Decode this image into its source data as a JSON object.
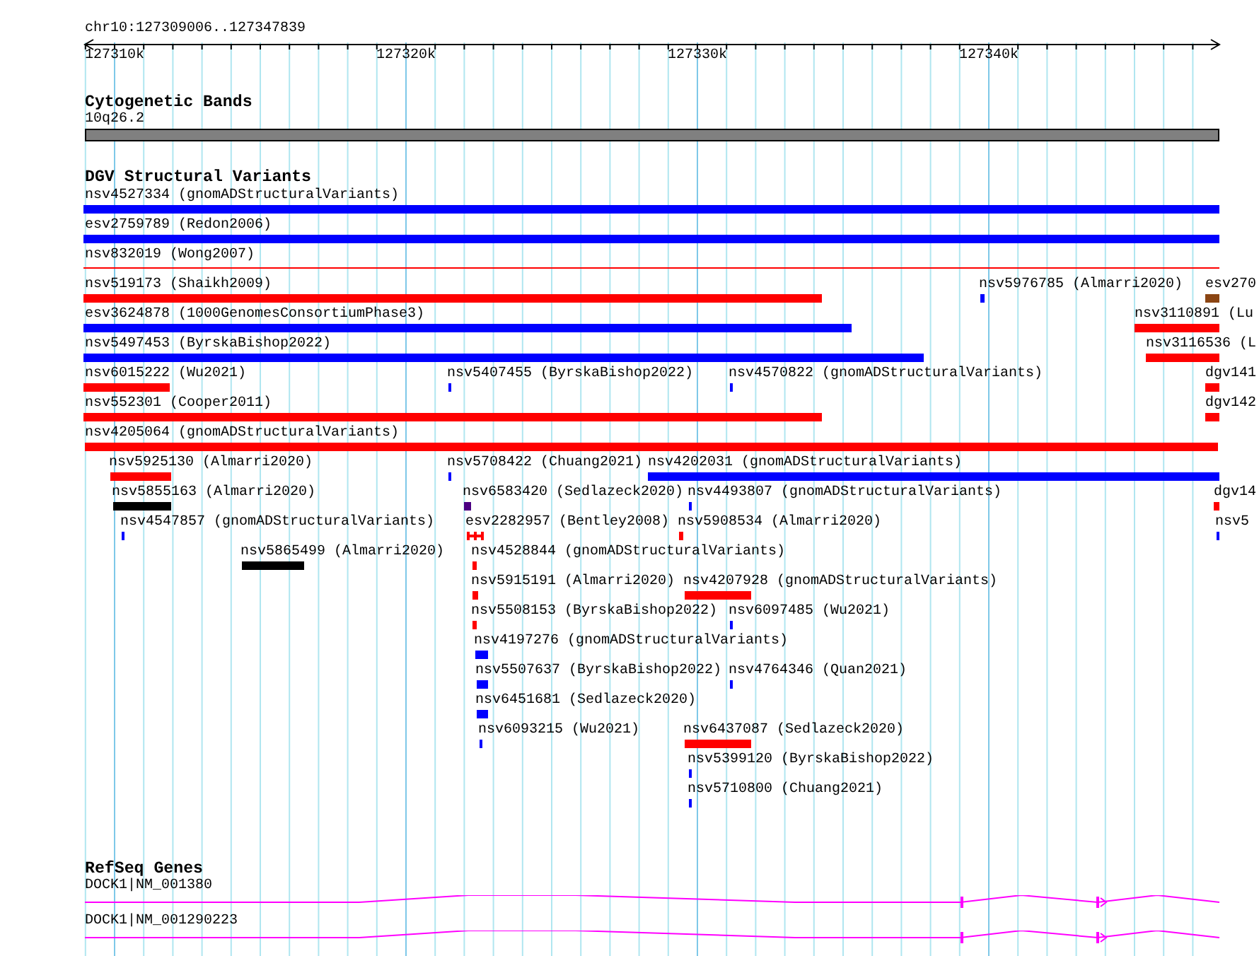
{
  "location": "chr10:127309006..127347839",
  "ruler": {
    "ticks": [
      "127310k",
      "127320k",
      "127330k",
      "127340k"
    ]
  },
  "tracks": [
    {
      "title": "Cytogenetic Bands",
      "kind": "bands",
      "features": [
        {
          "label": "10q26.2",
          "color": "#808080"
        }
      ]
    },
    {
      "title": "DGV Structural Variants",
      "kind": "variants",
      "rows": [
        {
          "features": [
            {
              "label": "nsv4527334 (gnomADStructuralVariants)",
              "kind": "bar",
              "color": "#0000ff"
            }
          ]
        },
        {
          "features": [
            {
              "label": "esv2759789 (Redon2006)",
              "kind": "bar",
              "color": "#0000ff"
            }
          ]
        },
        {
          "features": [
            {
              "label": "nsv832019 (Wong2007)",
              "kind": "line",
              "color": "#ff0000"
            }
          ]
        },
        {
          "features": [
            {
              "label": "nsv519173 (Shaikh2009)",
              "kind": "bar",
              "color": "#ff0000"
            },
            {
              "label": "nsv5976785 (Almarri2020)",
              "kind": "bar",
              "color": "#0000ff"
            },
            {
              "label": "esv270",
              "kind": "bar",
              "color": "#8b4513"
            }
          ]
        },
        {
          "features": [
            {
              "label": "esv3624878 (1000GenomesConsortiumPhase3)",
              "kind": "bar",
              "color": "#0000ff"
            },
            {
              "label": "nsv3110891 (Lu",
              "kind": "bar",
              "color": "#ff0000"
            }
          ]
        },
        {
          "features": [
            {
              "label": "nsv5497453 (ByrskaBishop2022)",
              "kind": "bar",
              "color": "#0000ff"
            },
            {
              "label": "nsv3116536 (L",
              "kind": "bar",
              "color": "#ff0000"
            }
          ]
        },
        {
          "features": [
            {
              "label": "nsv6015222 (Wu2021)",
              "kind": "bar",
              "color": "#ff0000"
            },
            {
              "label": "nsv5407455 (ByrskaBishop2022)",
              "kind": "bar",
              "color": "#0000ff"
            },
            {
              "label": "nsv4570822 (gnomADStructuralVariants)",
              "kind": "bar",
              "color": "#0000ff"
            },
            {
              "label": "dgv141",
              "kind": "bar",
              "color": "#ff0000"
            }
          ]
        },
        {
          "features": [
            {
              "label": "nsv552301 (Cooper2011)",
              "kind": "bar",
              "color": "#ff0000"
            },
            {
              "label": "dgv142",
              "kind": "bar",
              "color": "#ff0000"
            }
          ]
        },
        {
          "features": [
            {
              "label": "nsv4205064 (gnomADStructuralVariants)",
              "kind": "bar",
              "color": "#ff0000"
            }
          ]
        },
        {
          "features": [
            {
              "label": "nsv5925130 (Almarri2020)",
              "kind": "bar",
              "color": "#ff0000"
            },
            {
              "label": "nsv5708422 (Chuang2021)",
              "kind": "bar",
              "color": "#0000ff"
            },
            {
              "label": "nsv4202031 (gnomADStructuralVariants)",
              "kind": "bar",
              "color": "#0000ff"
            }
          ]
        },
        {
          "features": [
            {
              "label": "nsv5855163 (Almarri2020)",
              "kind": "bar",
              "color": "#000000"
            },
            {
              "label": "nsv6583420 (Sedlazeck2020)",
              "kind": "bar",
              "color": "#4b0082"
            },
            {
              "label": "nsv4493807 (gnomADStructuralVariants)",
              "kind": "bar",
              "color": "#0000ff"
            },
            {
              "label": "dgv14",
              "kind": "bar",
              "color": "#ff0000"
            }
          ]
        },
        {
          "features": [
            {
              "label": "nsv4547857 (gnomADStructuralVariants)",
              "kind": "bar",
              "color": "#0000ff"
            },
            {
              "label": "esv2282957 (Bentley2008)",
              "kind": "split",
              "color": "#ff0000"
            },
            {
              "label": "nsv5908534 (Almarri2020)",
              "kind": "bar",
              "color": "#ff0000"
            },
            {
              "label": "nsv5",
              "kind": "bar",
              "color": "#0000ff"
            }
          ]
        },
        {
          "features": [
            {
              "label": "nsv5865499 (Almarri2020)",
              "kind": "bar",
              "color": "#000000"
            },
            {
              "label": "nsv4528844 (gnomADStructuralVariants)",
              "kind": "bar",
              "color": "#ff0000"
            }
          ]
        },
        {
          "features": [
            {
              "label": "nsv5915191 (Almarri2020)",
              "kind": "bar",
              "color": "#ff0000"
            },
            {
              "label": "nsv4207928 (gnomADStructuralVariants)",
              "kind": "bar",
              "color": "#ff0000"
            }
          ]
        },
        {
          "features": [
            {
              "label": "nsv5508153 (ByrskaBishop2022)",
              "kind": "bar",
              "color": "#ff0000"
            },
            {
              "label": "nsv6097485 (Wu2021)",
              "kind": "bar",
              "color": "#0000ff"
            }
          ]
        },
        {
          "features": [
            {
              "label": "nsv4197276 (gnomADStructuralVariants)",
              "kind": "bar",
              "color": "#0000ff"
            }
          ]
        },
        {
          "features": [
            {
              "label": "nsv5507637 (ByrskaBishop2022)",
              "kind": "bar",
              "color": "#0000ff"
            },
            {
              "label": "nsv4764346 (Quan2021)",
              "kind": "bar",
              "color": "#0000ff"
            }
          ]
        },
        {
          "features": [
            {
              "label": "nsv6451681 (Sedlazeck2020)",
              "kind": "bar",
              "color": "#0000ff"
            }
          ]
        },
        {
          "features": [
            {
              "label": "nsv6093215 (Wu2021)",
              "kind": "bar",
              "color": "#0000ff"
            },
            {
              "label": "nsv6437087 (Sedlazeck2020)",
              "kind": "bar",
              "color": "#ff0000"
            }
          ]
        },
        {
          "features": [
            {
              "label": "nsv5399120 (ByrskaBishop2022)",
              "kind": "bar",
              "color": "#0000ff"
            }
          ]
        },
        {
          "features": [
            {
              "label": "nsv5710800 (Chuang2021)",
              "kind": "bar",
              "color": "#0000ff"
            }
          ]
        }
      ]
    },
    {
      "title": "RefSeq Genes",
      "kind": "genes",
      "features": [
        {
          "label": "DOCK1|NM_001380"
        },
        {
          "label": "DOCK1|NM_001290223"
        }
      ]
    }
  ]
}
